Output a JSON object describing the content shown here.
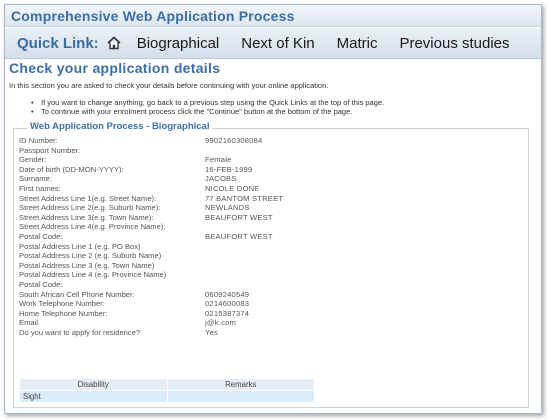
{
  "header": {
    "title": "Comprehensive Web Application Process"
  },
  "quicklinks": {
    "label": "Quick Link:",
    "icon": "home-icon",
    "items": [
      "Biographical",
      "Next of Kin",
      "Matric",
      "Previous studies"
    ]
  },
  "page": {
    "heading": "Check your application details",
    "intro": "In this section you are asked to check your details before continuing with your online application.",
    "bullets": [
      "If you want to change anything, go back to a previous step using the Quick Links at the top of this page.",
      "To continue with your enrolment process click the \"Continue\" button at the bottom of the page."
    ]
  },
  "section": {
    "legend": "Web Application Process - Biographical",
    "rows": [
      {
        "label": "ID Number:",
        "value": "9902160308084"
      },
      {
        "label": "Passport Number:",
        "value": ""
      },
      {
        "label": "Gender:",
        "value": "Female"
      },
      {
        "label": "Date of birth (DD-MON-YYYY):",
        "value": "16-FEB-1999"
      },
      {
        "label": "Surname:",
        "value": "JACOBS"
      },
      {
        "label": "First names:",
        "value": "NICOLE DONE"
      },
      {
        "label": "Street Address Line 1(e.g. Street Name):",
        "value": "77 BANTOM STREET"
      },
      {
        "label": "Street Address Line 2(e.g. Suburb Name):",
        "value": "NEWLANDS"
      },
      {
        "label": "Street Address Line 3(e.g. Town Name):",
        "value": "BEAUFORT WEST"
      },
      {
        "label": "Street Address Line 4(e.g. Province Name):",
        "value": ""
      },
      {
        "label": "Postal Code:",
        "value": "BEAUFORT WEST"
      },
      {
        "label": "Postal Address Line 1 (e.g. PO Box)",
        "value": ""
      },
      {
        "label": "Postal Address Line 2 (e.g. Suburb Name)",
        "value": ""
      },
      {
        "label": "Postal Address Line 3 (e.g. Town Name)",
        "value": ""
      },
      {
        "label": "Postal Address Line 4 (e.g. Province Name)",
        "value": ""
      },
      {
        "label": "Postal Code:",
        "value": ""
      },
      {
        "label": "South African Cell Phone Number:",
        "value": "0609240549"
      },
      {
        "label": "Work Telephone Number:",
        "value": "0214600083"
      },
      {
        "label": "Home Telephone Number:",
        "value": "0215387374"
      },
      {
        "label": "Email",
        "value": "j@k.com"
      },
      {
        "label": "Do you want to apply for residence?",
        "value": "Yes"
      }
    ]
  },
  "disability": {
    "headers": [
      "Disability",
      "Remarks"
    ],
    "rows": [
      {
        "disability": "Sight",
        "remarks": ""
      }
    ]
  },
  "colors": {
    "accent": "#3b6ea5",
    "table_cell": "#d9ecf7"
  }
}
